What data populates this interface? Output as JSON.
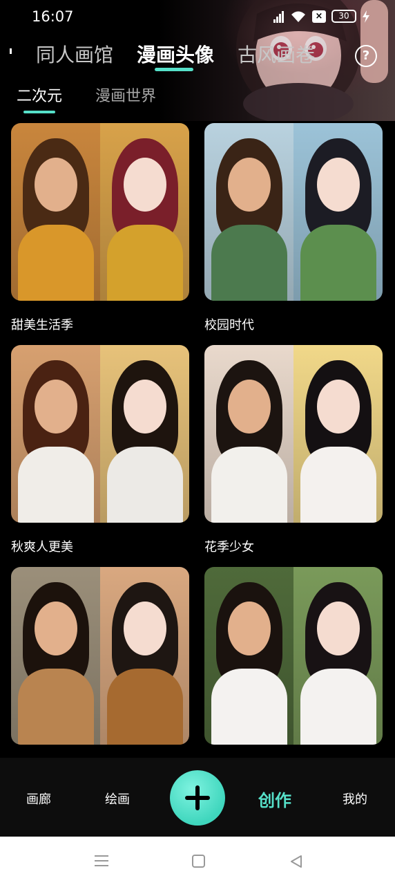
{
  "status_bar": {
    "time": "16:07",
    "battery": "30"
  },
  "top_tabs": {
    "items": [
      {
        "label": "同人画馆",
        "active": false
      },
      {
        "label": "漫画头像",
        "active": true
      },
      {
        "label": "古风画卷",
        "active": false
      }
    ],
    "help_symbol": "?"
  },
  "sub_tabs": [
    {
      "label": "二次元",
      "active": true
    },
    {
      "label": "漫画世界",
      "active": false
    }
  ],
  "cards": [
    {
      "title": "甜美生活季",
      "left_bg": "#c9863d",
      "right_bg": "#d8a24a",
      "left_hair": "#4a2a14",
      "right_hair": "#7a1f2a",
      "left_top": "#d9972a",
      "right_top": "#d4a12c"
    },
    {
      "title": "校园时代",
      "left_bg": "#b9d2df",
      "right_bg": "#9cc3d8",
      "left_hair": "#3a2416",
      "right_hair": "#1c1c24",
      "left_top": "#4c7a4e",
      "right_top": "#5c8f4e"
    },
    {
      "title": "秋爽人更美",
      "left_bg": "#d7a070",
      "right_bg": "#e7c27a",
      "left_hair": "#4a2212",
      "right_hair": "#1e140e",
      "left_top": "#f0ede8",
      "right_top": "#eceae6"
    },
    {
      "title": "花季少女",
      "left_bg": "#e9d9cc",
      "right_bg": "#f1d889",
      "left_hair": "#1c1410",
      "right_hair": "#141012",
      "left_top": "#f2f0ec",
      "right_top": "#f4f1ee"
    },
    {
      "title": "",
      "left_bg": "#9b8f7a",
      "right_bg": "#d9a880",
      "left_hair": "#1c120c",
      "right_hair": "#1e1612",
      "left_top": "#b98450",
      "right_top": "#a66a30"
    },
    {
      "title": "",
      "left_bg": "#4f6a3a",
      "right_bg": "#7a9a5a",
      "left_hair": "#1a120e",
      "right_hair": "#181214",
      "left_top": "#f4f2f0",
      "right_top": "#f4f2f0"
    }
  ],
  "bottom_nav": [
    {
      "label": "画廊",
      "active": false
    },
    {
      "label": "绘画",
      "active": false
    },
    {
      "label": "创作",
      "active": true
    },
    {
      "label": "我的",
      "active": false
    }
  ],
  "colors": {
    "accent": "#56e0c9",
    "background": "#000000"
  }
}
